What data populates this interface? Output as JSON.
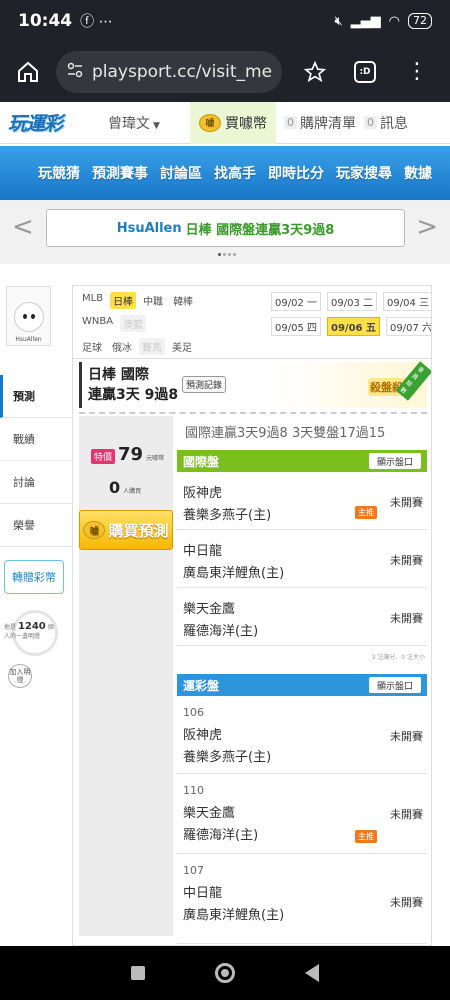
{
  "status_bar": {
    "time": "10:44",
    "left_icons": [
      "facebook-icon",
      "more-dots-icon"
    ],
    "battery": "72",
    "right_icons": [
      "mute-icon",
      "signal-icon",
      "wifi-icon",
      "battery-icon"
    ]
  },
  "browser": {
    "url": "playsport.cc/visit_mer",
    "tab_label": ":D"
  },
  "site_header": {
    "logo": "玩運彩",
    "username": "曾瑋文",
    "buy_coin": "買噱幣",
    "cart_count": "0",
    "cart_label": "購牌清單",
    "msg_count": "0",
    "msg_label": "訊息"
  },
  "main_nav": [
    "玩競猜",
    "預測賽事",
    "討論區",
    "找高手",
    "即時比分",
    "玩家搜尋",
    "數據"
  ],
  "banner": {
    "name": "HsuAllen",
    "text": "日棒 國際盤連贏3天9過8"
  },
  "profile": {
    "avatar_name": "HsuAllen",
    "menu": [
      "預測",
      "戰績",
      "討論",
      "榮譽"
    ],
    "gift_button": "轉贈彩幣",
    "likes_prefix": "他是",
    "likes_count": "1240",
    "likes_unit": "個",
    "likes_suffix": "人的一盞明燈",
    "add_fav": "加入明燈"
  },
  "filters": {
    "row1": [
      "MLB",
      "日棒",
      "中職",
      "韓棒"
    ],
    "row2": [
      "WNBA",
      "澳籃"
    ],
    "row3": [
      "足球",
      "俄冰",
      "賽馬",
      "美足"
    ],
    "selected": "日棒"
  },
  "dates": {
    "row1": [
      {
        "d": "09/02",
        "w": "一"
      },
      {
        "d": "09/03",
        "w": "二"
      },
      {
        "d": "09/04",
        "w": "三"
      }
    ],
    "row2": [
      {
        "d": "09/05",
        "w": "四"
      },
      {
        "d": "09/06",
        "w": "五"
      },
      {
        "d": "09/07",
        "w": "六"
      }
    ],
    "selected": "09/06"
  },
  "record": {
    "line1": "日棒 國際",
    "line2": "連贏3天 9過8",
    "record_button": "預測記錄",
    "badge": "殺盤殺手",
    "ribbon": "會員級數"
  },
  "purchase": {
    "special_tag": "特價",
    "price": "79",
    "price_unit": "元噱幣",
    "buyers": "0",
    "buyers_unit": "人購買",
    "buy_button": "購買預測"
  },
  "summary": "國際連贏3天9過8 3天雙盤17過15",
  "intl_section": {
    "title": "國際盤",
    "show_button": "顯示盤口",
    "games": [
      {
        "away": "阪神虎",
        "home": "養樂多燕子(主)",
        "status": "未開賽",
        "push": "主推"
      },
      {
        "away": "中日龍",
        "home": "廣島東洋鯉魚(主)",
        "status": "未開賽",
        "push": ""
      },
      {
        "away": "樂天金鷹",
        "home": "羅德海洋(主)",
        "status": "未開賽",
        "push": ""
      }
    ],
    "note": "3 注讓分、0 注大小"
  },
  "lottery_section": {
    "title": "運彩盤",
    "show_button": "顯示盤口",
    "games": [
      {
        "num": "106",
        "away": "阪神虎",
        "home": "養樂多燕子(主)",
        "status": "未開賽",
        "push": ""
      },
      {
        "num": "110",
        "away": "樂天金鷹",
        "home": "羅德海洋(主)",
        "status": "未開賽",
        "push": "主推"
      },
      {
        "num": "107",
        "away": "中日龍",
        "home": "廣島東洋鯉魚(主)",
        "status": "未開賽",
        "push": ""
      }
    ]
  }
}
